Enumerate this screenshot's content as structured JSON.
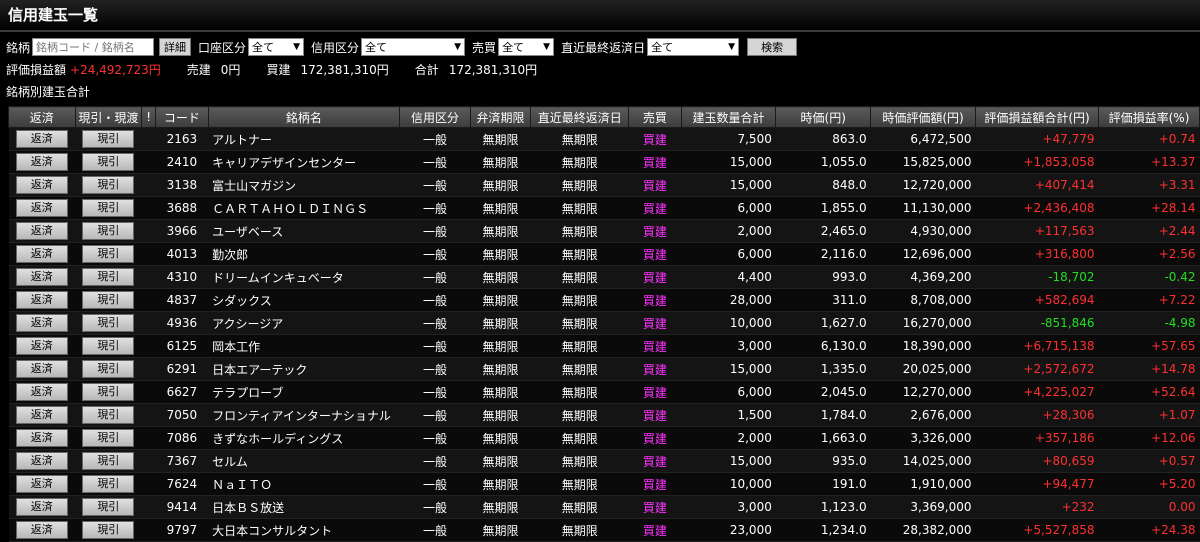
{
  "title": "信用建玉一覧",
  "filters": {
    "meigara_label": "銘柄",
    "meigara_placeholder": "銘柄コード / 銘柄名",
    "detail_button": "詳細",
    "account_label": "口座区分",
    "account_value": "全て",
    "credit_label": "信用区分",
    "credit_value": "全て",
    "trade_label": "売買",
    "trade_value": "全て",
    "due_label": "直近最終返済日",
    "due_value": "全て",
    "search_button": "検索"
  },
  "summary": {
    "pl_label": "評価損益額",
    "pl_value": "+24,492,723円",
    "sell_label": "売建",
    "sell_value": "0円",
    "buy_label": "買建",
    "buy_value": "172,381,310円",
    "total_label": "合計",
    "total_value": "172,381,310円"
  },
  "subtitle": "銘柄別建玉合計",
  "table": {
    "headers": [
      "返済",
      "現引・現渡",
      "!",
      "コード",
      "銘柄名",
      "信用区分",
      "弁済期限",
      "直近最終返済日",
      "売買",
      "建玉数量合計",
      "時価(円)",
      "時価評価額(円)",
      "評価損益額合計(円)",
      "評価損益率(%)"
    ],
    "repay_label": "返済",
    "genbiki_label": "現引",
    "rows": [
      {
        "code": "2163",
        "name": "アルトナー",
        "credit": "一般",
        "term": "無期限",
        "due": "無期限",
        "side": "買建",
        "qty": "7,500",
        "price": "863.0",
        "value": "6,472,500",
        "pl": "+47,779",
        "rate": "+0.74",
        "sign": "pos"
      },
      {
        "code": "2410",
        "name": "キャリアデザインセンター",
        "credit": "一般",
        "term": "無期限",
        "due": "無期限",
        "side": "買建",
        "qty": "15,000",
        "price": "1,055.0",
        "value": "15,825,000",
        "pl": "+1,853,058",
        "rate": "+13.37",
        "sign": "pos"
      },
      {
        "code": "3138",
        "name": "富士山マガジン",
        "credit": "一般",
        "term": "無期限",
        "due": "無期限",
        "side": "買建",
        "qty": "15,000",
        "price": "848.0",
        "value": "12,720,000",
        "pl": "+407,414",
        "rate": "+3.31",
        "sign": "pos"
      },
      {
        "code": "3688",
        "name": "ＣＡＲＴＡＨＯＬＤＩＮＧＳ",
        "credit": "一般",
        "term": "無期限",
        "due": "無期限",
        "side": "買建",
        "qty": "6,000",
        "price": "1,855.0",
        "value": "11,130,000",
        "pl": "+2,436,408",
        "rate": "+28.14",
        "sign": "pos"
      },
      {
        "code": "3966",
        "name": "ユーザベース",
        "credit": "一般",
        "term": "無期限",
        "due": "無期限",
        "side": "買建",
        "qty": "2,000",
        "price": "2,465.0",
        "value": "4,930,000",
        "pl": "+117,563",
        "rate": "+2.44",
        "sign": "pos"
      },
      {
        "code": "4013",
        "name": "勤次郎",
        "credit": "一般",
        "term": "無期限",
        "due": "無期限",
        "side": "買建",
        "qty": "6,000",
        "price": "2,116.0",
        "value": "12,696,000",
        "pl": "+316,800",
        "rate": "+2.56",
        "sign": "pos"
      },
      {
        "code": "4310",
        "name": "ドリームインキュベータ",
        "credit": "一般",
        "term": "無期限",
        "due": "無期限",
        "side": "買建",
        "qty": "4,400",
        "price": "993.0",
        "value": "4,369,200",
        "pl": "-18,702",
        "rate": "-0.42",
        "sign": "neg"
      },
      {
        "code": "4837",
        "name": "シダックス",
        "credit": "一般",
        "term": "無期限",
        "due": "無期限",
        "side": "買建",
        "qty": "28,000",
        "price": "311.0",
        "value": "8,708,000",
        "pl": "+582,694",
        "rate": "+7.22",
        "sign": "pos"
      },
      {
        "code": "4936",
        "name": "アクシージア",
        "credit": "一般",
        "term": "無期限",
        "due": "無期限",
        "side": "買建",
        "qty": "10,000",
        "price": "1,627.0",
        "value": "16,270,000",
        "pl": "-851,846",
        "rate": "-4.98",
        "sign": "neg"
      },
      {
        "code": "6125",
        "name": "岡本工作",
        "credit": "一般",
        "term": "無期限",
        "due": "無期限",
        "side": "買建",
        "qty": "3,000",
        "price": "6,130.0",
        "value": "18,390,000",
        "pl": "+6,715,138",
        "rate": "+57.65",
        "sign": "pos"
      },
      {
        "code": "6291",
        "name": "日本エアーテック",
        "credit": "一般",
        "term": "無期限",
        "due": "無期限",
        "side": "買建",
        "qty": "15,000",
        "price": "1,335.0",
        "value": "20,025,000",
        "pl": "+2,572,672",
        "rate": "+14.78",
        "sign": "pos"
      },
      {
        "code": "6627",
        "name": "テラプローブ",
        "credit": "一般",
        "term": "無期限",
        "due": "無期限",
        "side": "買建",
        "qty": "6,000",
        "price": "2,045.0",
        "value": "12,270,000",
        "pl": "+4,225,027",
        "rate": "+52.64",
        "sign": "pos"
      },
      {
        "code": "7050",
        "name": "フロンティアインターナショナル",
        "credit": "一般",
        "term": "無期限",
        "due": "無期限",
        "side": "買建",
        "qty": "1,500",
        "price": "1,784.0",
        "value": "2,676,000",
        "pl": "+28,306",
        "rate": "+1.07",
        "sign": "pos"
      },
      {
        "code": "7086",
        "name": "きずなホールディングス",
        "credit": "一般",
        "term": "無期限",
        "due": "無期限",
        "side": "買建",
        "qty": "2,000",
        "price": "1,663.0",
        "value": "3,326,000",
        "pl": "+357,186",
        "rate": "+12.06",
        "sign": "pos"
      },
      {
        "code": "7367",
        "name": "セルム",
        "credit": "一般",
        "term": "無期限",
        "due": "無期限",
        "side": "買建",
        "qty": "15,000",
        "price": "935.0",
        "value": "14,025,000",
        "pl": "+80,659",
        "rate": "+0.57",
        "sign": "pos"
      },
      {
        "code": "7624",
        "name": "ＮａＩＴＯ",
        "credit": "一般",
        "term": "無期限",
        "due": "無期限",
        "side": "買建",
        "qty": "10,000",
        "price": "191.0",
        "value": "1,910,000",
        "pl": "+94,477",
        "rate": "+5.20",
        "sign": "pos"
      },
      {
        "code": "9414",
        "name": "日本ＢＳ放送",
        "credit": "一般",
        "term": "無期限",
        "due": "無期限",
        "side": "買建",
        "qty": "3,000",
        "price": "1,123.0",
        "value": "3,369,000",
        "pl": "+232",
        "rate": "0.00",
        "sign": "pos"
      },
      {
        "code": "9797",
        "name": "大日本コンサルタント",
        "credit": "一般",
        "term": "無期限",
        "due": "無期限",
        "side": "買建",
        "qty": "23,000",
        "price": "1,234.0",
        "value": "28,382,000",
        "pl": "+5,527,858",
        "rate": "+24.38",
        "sign": "pos"
      }
    ]
  },
  "colors": {
    "positive": "#ff3030",
    "negative": "#22dd22",
    "buy": "#ff33ff"
  }
}
